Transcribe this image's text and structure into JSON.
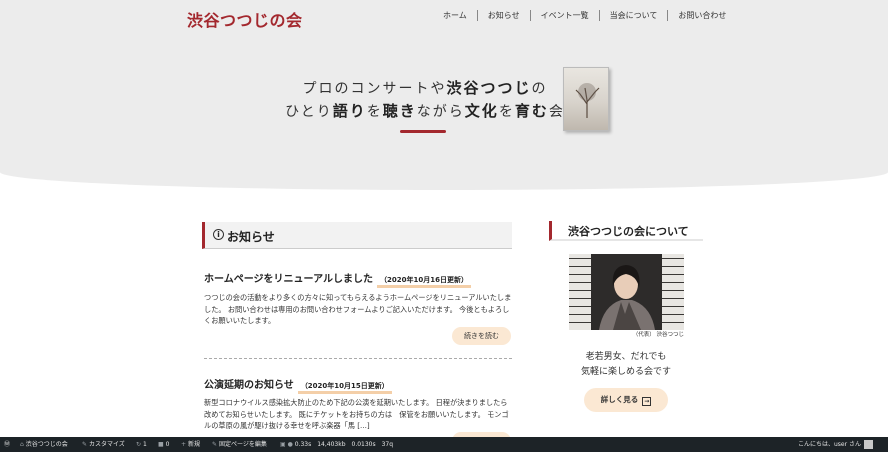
{
  "site": {
    "logo": "渋谷つつじの会"
  },
  "nav": [
    "ホーム",
    "お知らせ",
    "イベント一覧",
    "当会について",
    "お問い合わせ"
  ],
  "hero": {
    "line1_a": "プロのコンサートや",
    "line1_b": "渋谷つつじ",
    "line1_c": "の",
    "line2": [
      {
        "t": "ひとり",
        "b": false
      },
      {
        "t": "語り",
        "b": true
      },
      {
        "t": "を",
        "b": false
      },
      {
        "t": "聴き",
        "b": true
      },
      {
        "t": "ながら",
        "b": false
      },
      {
        "t": "文化",
        "b": true
      },
      {
        "t": "を",
        "b": false
      },
      {
        "t": "育む",
        "b": true
      },
      {
        "t": "会",
        "b": false
      }
    ]
  },
  "news": {
    "heading_icon": "info-circle-icon",
    "heading": "お知らせ",
    "posts": [
      {
        "title": "ホームページをリニューアルしました",
        "date": "（2020年10月16日更新）",
        "body": "つつじの会の活動をより多くの方々に知ってもらえるようホームページをリニューアルいたしました。 お問い合わせは専用のお問い合わせフォームよりご記入いただけます。 今後ともよろしくお願いいたします。",
        "readmore": "続きを読む"
      },
      {
        "title": "公演延期のお知らせ",
        "date": "（2020年10月15日更新）",
        "body": "新型コロナウイルス感染拡大防止のため下記の公演を延期いたします。 日程が決まりましたら改めてお知らせいたします。 既にチケットをお持ちの方は　保管をお願いいたします。 モンゴルの草原の風が駆け抜ける幸せを呼ぶ楽器「馬 [...]",
        "readmore": "続きを読む"
      }
    ]
  },
  "sidebar": {
    "heading": "渋谷つつじの会について",
    "caption": "（代表） 渋谷つつじ",
    "text1": "老若男女、だれでも",
    "text2": "気軽に楽しめる会です",
    "button": "詳しく見る",
    "button_icon": "arrow-right-box-icon"
  },
  "adminbar": {
    "site": "渋谷つつじの会",
    "customize": "カスタマイズ",
    "updates": "1",
    "comments": "0",
    "new": "新規",
    "edit": "固定ページを編集",
    "stats": "0.33s　14,403kb　0.0130s　37q",
    "greeting": "こんにちは、user さん"
  },
  "colors": {
    "accent": "#a3282e",
    "button_bg": "#fbe8d3",
    "admin_bg": "#1d2327"
  }
}
